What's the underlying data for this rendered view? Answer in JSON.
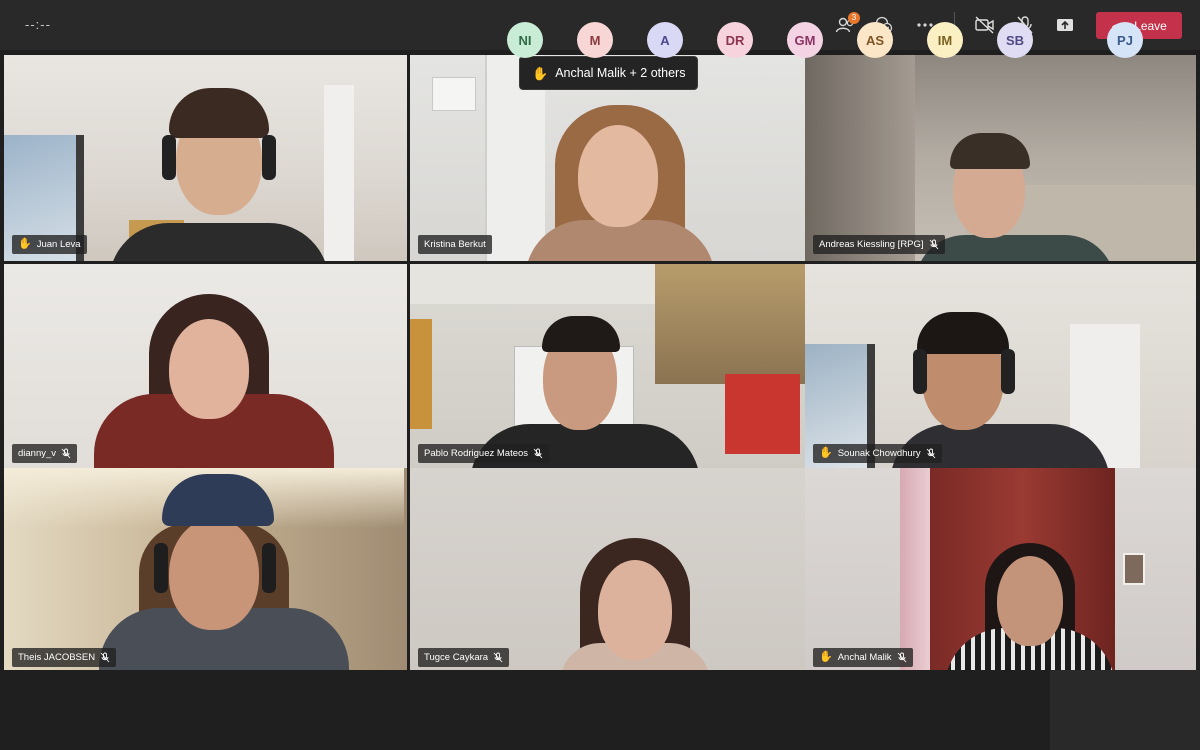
{
  "header": {
    "timer": "--:--",
    "participants_badge": "3",
    "leave_label": "Leave"
  },
  "raised_hands_banner": "Anchal Malik + 2 others",
  "tiles": [
    {
      "name": "Juan Leva",
      "hand": true,
      "muted": false
    },
    {
      "name": "Kristina Berkut",
      "hand": false,
      "muted": false
    },
    {
      "name": "Andreas Kiessling [RPG]",
      "hand": false,
      "muted": true
    },
    {
      "name": "dianny_v",
      "hand": false,
      "muted": true
    },
    {
      "name": "Pablo Rodriguez Mateos",
      "hand": false,
      "muted": true
    },
    {
      "name": "Sounak Chowdhury",
      "hand": true,
      "muted": true
    },
    {
      "name": "Theis JACOBSEN",
      "hand": false,
      "muted": true
    },
    {
      "name": "Tugce Caykara",
      "hand": false,
      "muted": true
    },
    {
      "name": "Anchal Malik",
      "hand": true,
      "muted": true
    }
  ],
  "roster": [
    {
      "initials": "NI",
      "bg": "#c8ecd5",
      "fg": "#2f6b46"
    },
    {
      "initials": "M",
      "bg": "#f8d6d6",
      "fg": "#8a3b3b"
    },
    {
      "initials": "A",
      "bg": "#d9d9f5",
      "fg": "#4a4a8c"
    },
    {
      "initials": "DR",
      "bg": "#f6d3dd",
      "fg": "#8c3552"
    },
    {
      "initials": "GM",
      "bg": "#f4d4e4",
      "fg": "#8a3466"
    },
    {
      "initials": "AS",
      "bg": "#fbe6c8",
      "fg": "#7e5423"
    },
    {
      "initials": "IM",
      "bg": "#fbf0c4",
      "fg": "#7a6222"
    },
    {
      "initials": "SB",
      "bg": "#dfdcf3",
      "fg": "#4f4a86"
    },
    {
      "initials": "PJ",
      "bg": "#d6e4f7",
      "fg": "#3a5a8a"
    }
  ],
  "colors": {
    "leave": "#c4314b",
    "hand": "#f0c33c",
    "badge": "#e8762b"
  }
}
